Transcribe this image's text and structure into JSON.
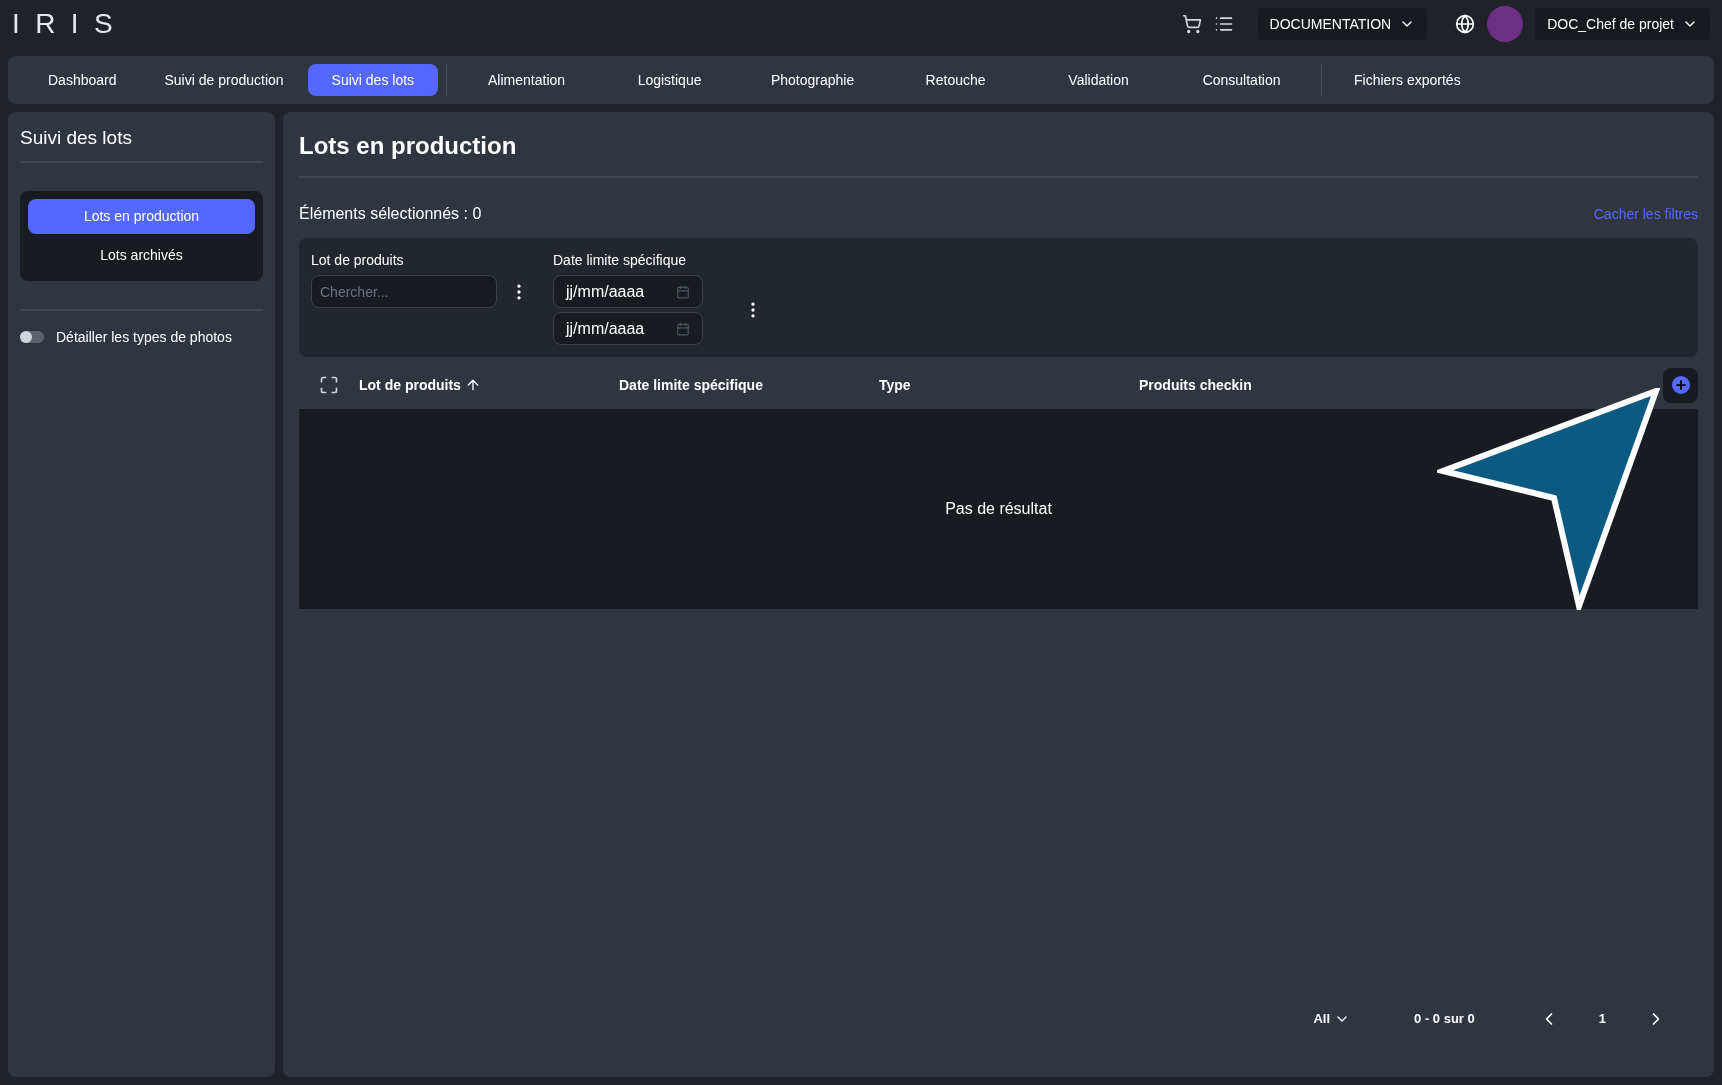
{
  "header": {
    "logo": "IRIS",
    "documentation": "DOCUMENTATION",
    "user": "DOC_Chef de projet"
  },
  "tab_groups": [
    {
      "tabs": [
        {
          "label": "Dashboard",
          "selected": false
        },
        {
          "label": "Suivi de production",
          "selected": false
        },
        {
          "label": "Suivi des lots",
          "selected": true
        }
      ]
    },
    {
      "tabs": [
        {
          "label": "Alimentation",
          "selected": false
        },
        {
          "label": "Logistique",
          "selected": false
        },
        {
          "label": "Photographie",
          "selected": false
        },
        {
          "label": "Retouche",
          "selected": false
        },
        {
          "label": "Validation",
          "selected": false
        },
        {
          "label": "Consultation",
          "selected": false
        }
      ]
    },
    {
      "tabs": [
        {
          "label": "Fichiers exportés",
          "selected": false
        }
      ]
    }
  ],
  "sidebar": {
    "title": "Suivi des lots",
    "items": [
      {
        "label": "Lots en production",
        "selected": true
      },
      {
        "label": "Lots archivés",
        "selected": false
      }
    ],
    "toggle": {
      "label": "Détailler les types de photos",
      "on": false
    }
  },
  "main": {
    "title": "Lots en production",
    "selected_count": "Éléments sélectionnés : 0",
    "hide_filters": "Cacher les filtres",
    "filters": [
      {
        "kind": "text",
        "label": "Lot de produits",
        "placeholder": "Chercher..."
      },
      {
        "kind": "date_range",
        "label": "Date limite spécifique",
        "placeholders": [
          "jj/mm/aaaa",
          "jj/mm/aaaa"
        ]
      }
    ],
    "table": {
      "columns": [
        {
          "label": "Lot de produits",
          "sorted": true
        },
        {
          "label": "Date limite spécifique",
          "sorted": false
        },
        {
          "label": "Type",
          "sorted": false
        },
        {
          "label": "Produits checkin",
          "sorted": false
        }
      ],
      "empty": "Pas de résultat"
    },
    "pagination": {
      "per_page": "All",
      "range": "0 - 0 sur 0",
      "page": "1"
    }
  }
}
